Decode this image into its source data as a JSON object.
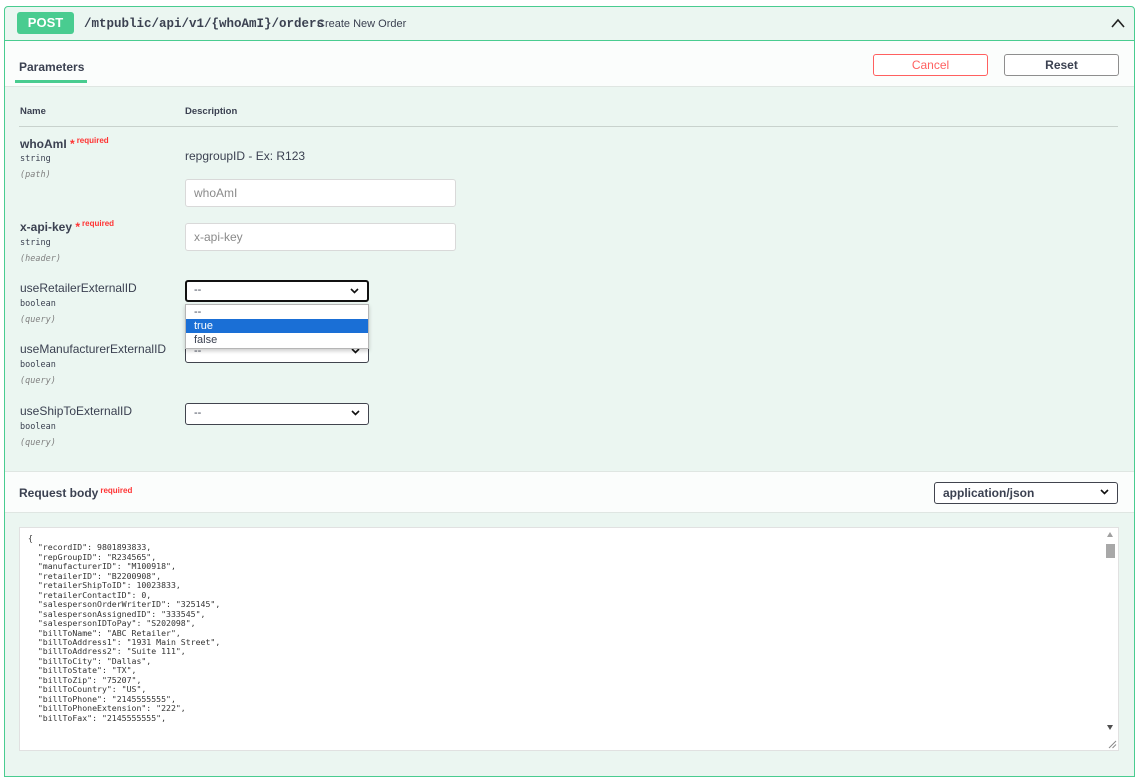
{
  "operation": {
    "method": "POST",
    "path": "/mtpublic/api/v1/{whoAmI}/orders",
    "description": "Create New Order"
  },
  "tabs": {
    "parameters": "Parameters"
  },
  "buttons": {
    "cancel": "Cancel",
    "reset": "Reset"
  },
  "columns": {
    "name": "Name",
    "description": "Description"
  },
  "required_label": "required",
  "params": [
    {
      "name": "whoAmI",
      "type": "string",
      "in": "(path)",
      "required": true,
      "description": "repgroupID - Ex: R123",
      "placeholder": "whoAmI"
    },
    {
      "name": "x-api-key",
      "type": "string",
      "in": "(header)",
      "required": true,
      "placeholder": "x-api-key"
    },
    {
      "name": "useRetailerExternalID",
      "type": "boolean",
      "in": "(query)",
      "value": "--"
    },
    {
      "name": "useManufacturerExternalID",
      "type": "boolean",
      "in": "(query)",
      "value": "--"
    },
    {
      "name": "useShipToExternalID",
      "type": "boolean",
      "in": "(query)",
      "value": "--"
    }
  ],
  "dropdown_options": [
    "--",
    "true",
    "false"
  ],
  "dropdown_highlighted": "true",
  "request_body": {
    "title": "Request body",
    "content_type": "application/json",
    "code": "{\n  \"recordID\": 9801893833,\n  \"repGroupID\": \"R234565\",\n  \"manufacturerID\": \"M100918\",\n  \"retailerID\": \"B2200908\",\n  \"retailerShipToID\": 10023833,\n  \"retailerContactID\": 0,\n  \"salespersonOrderWriterID\": \"325145\",\n  \"salespersonAssignedID\": \"333545\",\n  \"salespersonIDToPay\": \"S202098\",\n  \"billToName\": \"ABC Retailer\",\n  \"billToAddress1\": \"1931 Main Street\",\n  \"billToAddress2\": \"Suite 111\",\n  \"billToCity\": \"Dallas\",\n  \"billToState\": \"TX\",\n  \"billToZip\": \"75207\",\n  \"billToCountry\": \"US\",\n  \"billToPhone\": \"2145555555\",\n  \"billToPhoneExtension\": \"222\",\n  \"billToFax\": \"2145555555\","
  },
  "colors": {
    "post_green": "#49cc90",
    "panel_bg": "#ebf6f1",
    "cancel_red": "#ff6060",
    "required_red": "#ff3333",
    "dropdown_highlight": "#1a6fd6"
  }
}
